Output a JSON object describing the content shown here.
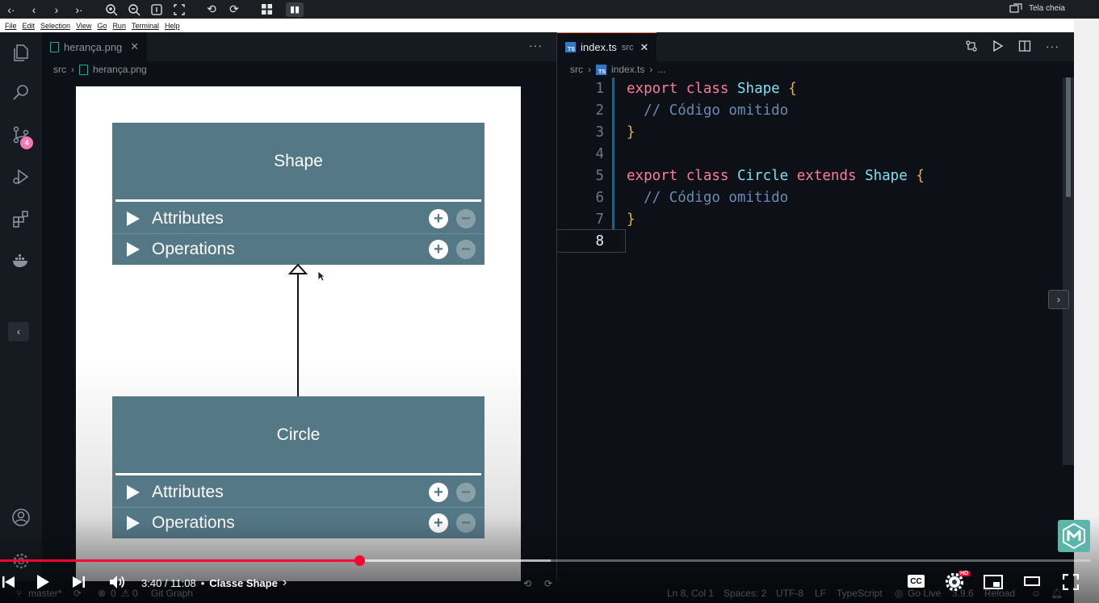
{
  "topbar": {
    "icons": [
      "step-back-icon",
      "back-icon",
      "forward-icon",
      "step-forward-icon",
      "zoom-in-icon",
      "zoom-out-icon",
      "actual-size-icon",
      "fit-icon",
      "rotate-left-icon",
      "rotate-right-icon",
      "grid-icon",
      "pause-icon"
    ],
    "fullscreen_label": "Tela cheia"
  },
  "menubar": {
    "items": [
      "File",
      "Edit",
      "Selection",
      "View",
      "Go",
      "Run",
      "Terminal",
      "Help"
    ]
  },
  "activity_bar": {
    "source_control_badge": "4"
  },
  "left_editor": {
    "tab_label": "herança.png",
    "breadcrumb": {
      "root": "src",
      "file": "herança.png"
    },
    "diagram": {
      "classes": [
        {
          "name": "Shape",
          "rows": [
            "Attributes",
            "Operations"
          ]
        },
        {
          "name": "Circle",
          "rows": [
            "Attributes",
            "Operations"
          ]
        }
      ]
    }
  },
  "right_editor": {
    "tab_label": "index.ts",
    "tab_description": "src",
    "breadcrumb": {
      "root": "src",
      "file": "index.ts",
      "tail": "..."
    },
    "line_numbers": [
      "1",
      "2",
      "3",
      "4",
      "5",
      "6",
      "7",
      "8"
    ],
    "active_line": 8
  },
  "statusbar": {
    "branch": "master*",
    "errors": "0",
    "warnings": "0",
    "git_graph": "Git Graph",
    "cursor": "Ln 8, Col 1",
    "spaces": "Spaces: 2",
    "encoding": "UTF-8",
    "eol": "LF",
    "language": "TypeScript",
    "go_live": "Go Live",
    "version": "3.9.6",
    "reload": "Reload"
  },
  "player": {
    "time": "3:40 / 11:08",
    "separator": "•",
    "chapter": "Classe Shape",
    "cc_label": "CC",
    "hd_label": "HD",
    "progress_fraction": 0.3293,
    "buffered_fraction": 0.505
  },
  "colors": {
    "uml_fill": "#557886",
    "keyword": "#ff7b9c",
    "class_name": "#79e2f2",
    "brace": "#e3b341",
    "comment": "#6a8bb3",
    "progress": "#ff0033"
  }
}
